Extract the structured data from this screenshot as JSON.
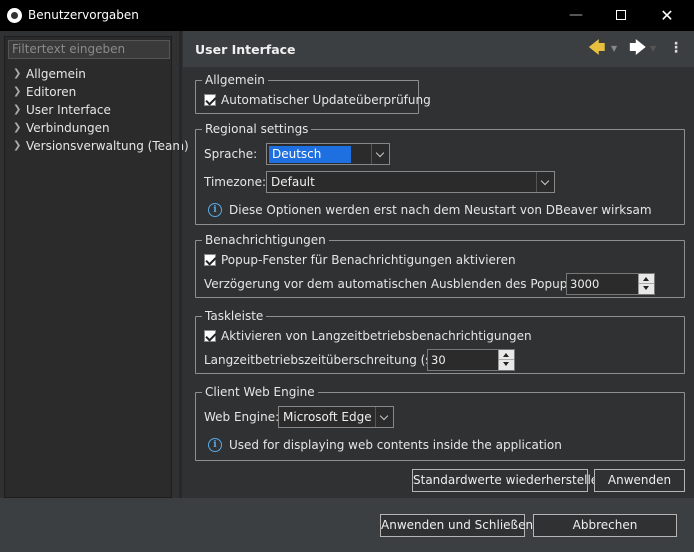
{
  "window": {
    "title": "Benutzervorgaben",
    "minimize_glyph": "—",
    "close_glyph": "✕"
  },
  "sidebar": {
    "filter_placeholder": "Filtertext eingeben",
    "items": [
      {
        "label": "Allgemein"
      },
      {
        "label": "Editoren"
      },
      {
        "label": "User Interface"
      },
      {
        "label": "Verbindungen"
      },
      {
        "label": "Versionsverwaltung (Team)"
      }
    ]
  },
  "header": {
    "title": "User Interface",
    "back_icon": "arrow-left-icon",
    "forward_icon": "arrow-right-icon",
    "menu_icon": "view-menu-icon"
  },
  "groups": {
    "allgemein": {
      "legend": "Allgemein",
      "auto_update_label": "Automatischer Updateüberprüfung",
      "auto_update_checked": true
    },
    "regional": {
      "legend": "Regional settings",
      "language_label": "Sprache:",
      "language_value": "Deutsch",
      "timezone_label": "Timezone:",
      "timezone_value": "Default",
      "restart_note": "Diese Optionen werden erst nach dem Neustart von DBeaver wirksam"
    },
    "notifications": {
      "legend": "Benachrichtigungen",
      "popup_label": "Popup-Fenster für Benachrichtigungen aktivieren",
      "popup_checked": true,
      "delay_label": "Verzögerung vor dem automatischen Ausblenden des Popups (ms):",
      "delay_value": "3000"
    },
    "taskbar": {
      "legend": "Taskleiste",
      "long_ops_label": "Aktivieren von Langzeitbetriebsbenachrichtigungen",
      "long_ops_checked": true,
      "threshold_label": "Langzeitbetriebszeitüberschreitung (sec):",
      "threshold_value": "30"
    },
    "web_engine": {
      "legend": "Client Web Engine",
      "engine_label": "Web Engine:",
      "engine_value": "Microsoft Edge",
      "info_note": "Used for displaying web contents inside the application"
    }
  },
  "actions": {
    "restore_defaults": "Standardwerte wiederherstellen",
    "apply": "Anwenden",
    "apply_close": "Anwenden und Schließen",
    "cancel": "Abbrechen"
  },
  "colors": {
    "background": "#2f3133",
    "titlebar": "#000000",
    "selection": "#1e6fe0",
    "back_arrow": "#e8c040",
    "info": "#5aa9e6"
  }
}
